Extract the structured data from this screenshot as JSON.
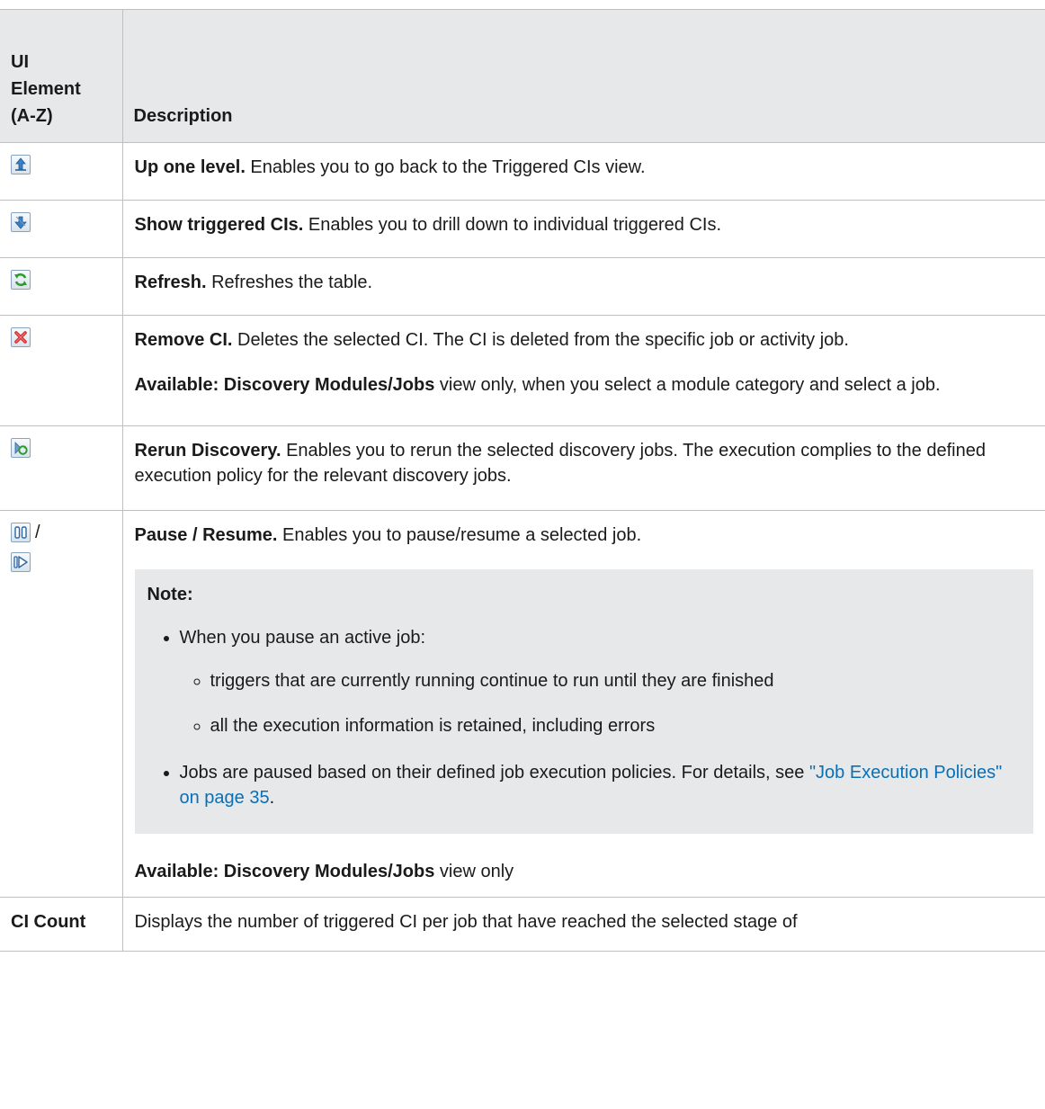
{
  "table": {
    "header": {
      "col1": "UI Element (A-Z)",
      "col1_lines": [
        "UI",
        "Element",
        "(A-Z)"
      ],
      "col2": "Description"
    },
    "rows": [
      {
        "icon": "up-one-level-icon",
        "title": "Up one level.",
        "text": " Enables you to go back to the Triggered CIs view."
      },
      {
        "icon": "show-triggered-cis-icon",
        "title": "Show triggered CIs.",
        "text": " Enables you to drill down to individual triggered CIs."
      },
      {
        "icon": "refresh-icon",
        "title": "Refresh.",
        "text": " Refreshes the table."
      },
      {
        "icon": "remove-ci-icon",
        "title": "Remove CI.",
        "text": " Deletes the selected CI. The CI is deleted from the specific job or activity job.",
        "avail_label": "Available: Discovery Modules/Jobs",
        "avail_text": " view only, when you select a module category and select a job."
      },
      {
        "icon": "rerun-discovery-icon",
        "title": "Rerun Discovery.",
        "text": " Enables you to rerun the selected discovery jobs. The execution complies to the defined execution policy for the relevant discovery jobs."
      },
      {
        "icons": [
          "pause-icon",
          "resume-icon"
        ],
        "icon_sep": "/",
        "title": "Pause / Resume.",
        "text": " Enables you to pause/resume a selected job.",
        "note": {
          "title": "Note:",
          "items": [
            {
              "text": "When you pause an active job:",
              "subitems": [
                "triggers that are currently running continue to run until they are finished",
                "all the execution information is retained, including errors"
              ]
            },
            {
              "text": "Jobs are paused based on their defined job execution policies. For details, see ",
              "link": "\"Job Execution Policies\" on page 35",
              "after": "."
            }
          ]
        },
        "avail_label": "Available: Discovery Modules/Jobs",
        "avail_text": " view only"
      },
      {
        "label": "CI Count",
        "text": "Displays the number of triggered CI per job that have reached the selected stage of"
      }
    ]
  },
  "colors": {
    "header_bg": "#e6e8ea",
    "note_bg": "#e6e8ea",
    "border": "#bfbfbf",
    "link": "#0a6fb5"
  }
}
